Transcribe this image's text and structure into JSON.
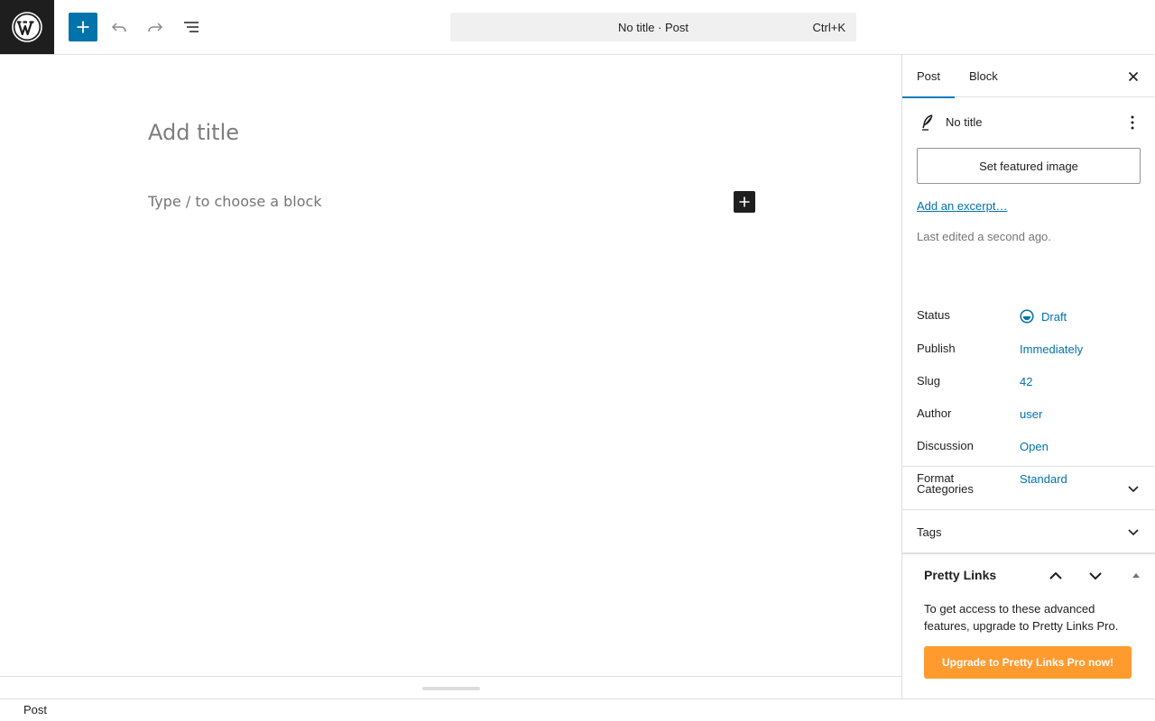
{
  "header": {
    "logo_icon": "wordpress-logo",
    "add_block_icon": "plus-icon",
    "undo_icon": "undo-icon",
    "redo_icon": "redo-icon",
    "list_view_icon": "list-view-icon",
    "command_center": {
      "title": "No title · Post",
      "shortcut": "Ctrl+K"
    }
  },
  "editor": {
    "title_placeholder": "Add title",
    "block_placeholder": "Type / to choose a block",
    "inserter_icon": "plus-icon"
  },
  "sidebar": {
    "tabs": [
      {
        "label": "Post",
        "active": true
      },
      {
        "label": "Block",
        "active": false
      }
    ],
    "close_icon": "close-icon",
    "post_card": {
      "icon": "post-quill-icon",
      "title": "No title",
      "more_icon": "more-vertical-icon"
    },
    "featured_image_label": "Set featured image",
    "excerpt_link": "Add an excerpt…",
    "last_edited": "Last edited a second ago.",
    "meta": [
      {
        "label": "Status",
        "value": "Draft",
        "icon": "draft-status-icon"
      },
      {
        "label": "Publish",
        "value": "Immediately"
      },
      {
        "label": "Slug",
        "value": "42"
      },
      {
        "label": "Author",
        "value": "user"
      },
      {
        "label": "Discussion",
        "value": "Open"
      },
      {
        "label": "Format",
        "value": "Standard"
      }
    ],
    "panels": [
      {
        "label": "Categories",
        "icon": "chevron-down-icon"
      },
      {
        "label": "Tags",
        "icon": "chevron-down-icon"
      }
    ],
    "pretty_links": {
      "title": "Pretty Links",
      "text": "To get access to these advanced features, upgrade to Pretty Links Pro.",
      "button_label": "Upgrade to Pretty Links Pro now!",
      "button_color": "#ff9a2e"
    }
  },
  "footer": {
    "breadcrumb": "Post"
  },
  "colors": {
    "accent": "#0073aa",
    "tab_indicator": "#007cba",
    "dark": "#1e1e1e"
  }
}
